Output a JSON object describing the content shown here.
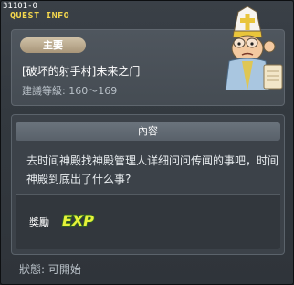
{
  "window": {
    "quest_id": "31101-0",
    "title": "QUEST INFO"
  },
  "header": {
    "badge": "主要",
    "quest_title": "[破坏的射手村]未来之门",
    "level_label": "建議等級:",
    "level_range": "160～169"
  },
  "content": {
    "section_title": "內容",
    "description": "去时间神殿找神殿管理人详细问问传闻的事吧，时间神殿到底出了什么事?",
    "reward_label": "獎勵",
    "reward_icon": "EXP"
  },
  "footer": {
    "status_label": "狀態:",
    "status_value": "可開始"
  },
  "colors": {
    "title": "#f3d64d",
    "badge": "#bfae90",
    "exp_fill": "#e6f23a",
    "exp_outline": "#2f6b1e"
  }
}
